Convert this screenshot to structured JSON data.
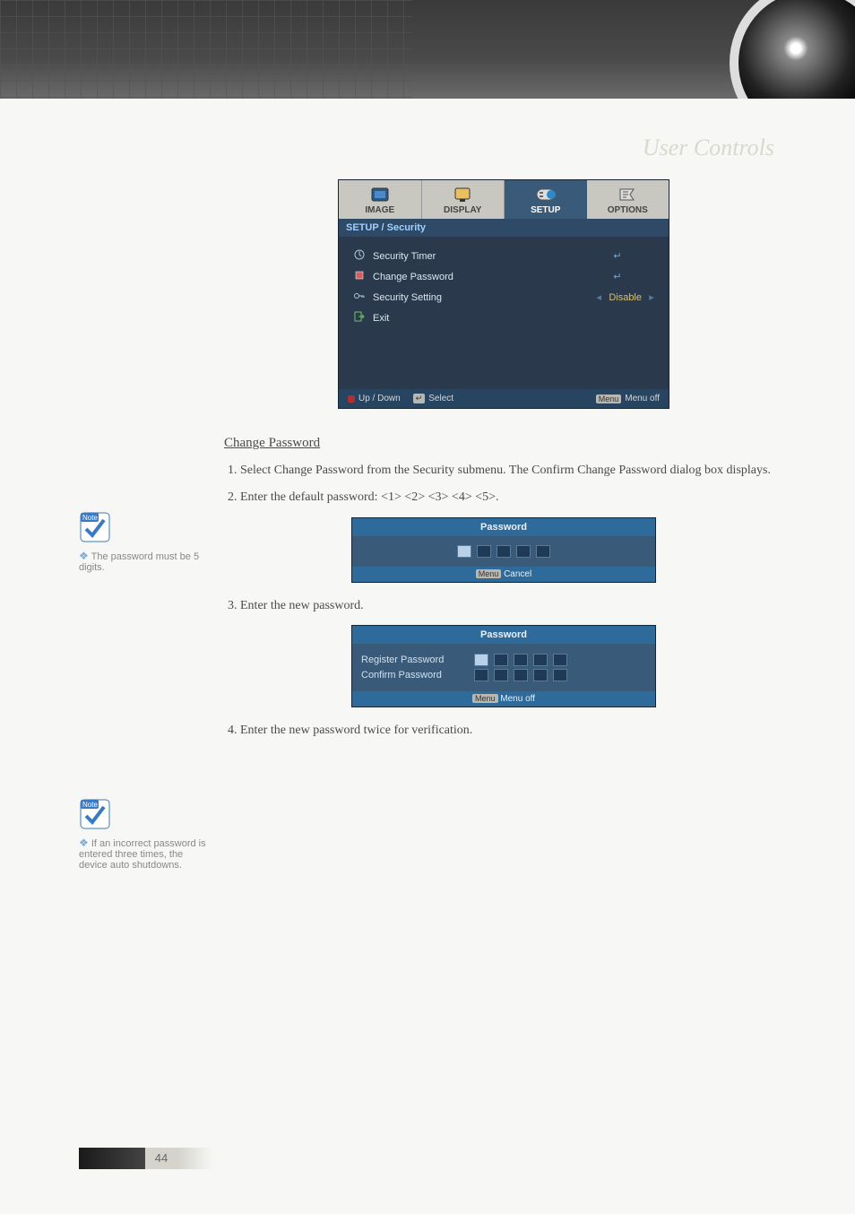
{
  "page": {
    "section_title": "User Controls",
    "number": "44"
  },
  "osd": {
    "tabs": [
      {
        "label": "IMAGE"
      },
      {
        "label": "DISPLAY"
      },
      {
        "label": "SETUP"
      },
      {
        "label": "OPTIONS"
      }
    ],
    "breadcrumb": "SETUP / Security",
    "rows": {
      "security_timer": {
        "label": "Security Timer"
      },
      "change_password": {
        "label": "Change Password"
      },
      "security_setting": {
        "label": "Security Setting",
        "value": "Disable"
      },
      "exit": {
        "label": "Exit"
      }
    },
    "footer": {
      "updown": "Up / Down",
      "select": "Select",
      "menu_key": "Menu",
      "menuoff": "Menu off"
    }
  },
  "body": {
    "heading": "Change Password",
    "step1": "1. Select Change Password from the Security submenu. The Confirm Change Password dialog box displays.",
    "step2": "2. Enter the default password: <1> <2> <3> <4> <5>.",
    "step3": "3. Enter the new password.",
    "step4": "4. Enter the new password twice for verification."
  },
  "pw1": {
    "title": "Password",
    "footer_key": "Menu",
    "footer_label": "Cancel"
  },
  "pw2": {
    "title": "Password",
    "register": "Register Password",
    "confirm": "Confirm Password",
    "footer_key": "Menu",
    "footer_label": "Menu off"
  },
  "notes": {
    "n1": "The password must be 5 digits.",
    "n2": "If an incorrect password is entered three times, the device auto shutdowns."
  }
}
